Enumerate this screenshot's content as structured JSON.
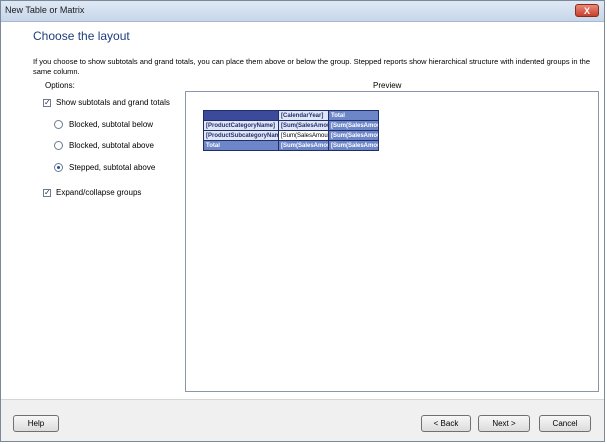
{
  "window": {
    "title": "New Table or Matrix",
    "close_label": "X"
  },
  "page": {
    "heading": "Choose the layout",
    "description": "If you choose to show subtotals and grand totals, you can place them above or below the group. Stepped reports show hierarchical structure with indented groups in the same column."
  },
  "options": {
    "label": "Options:",
    "show_subtotals": {
      "label": "Show subtotals and grand totals",
      "checked": true
    },
    "layouts": [
      {
        "label": "Blocked, subtotal below",
        "selected": false
      },
      {
        "label": "Blocked, subtotal above",
        "selected": false
      },
      {
        "label": "Stepped, subtotal above",
        "selected": true
      }
    ],
    "expand_collapse": {
      "label": "Expand/collapse groups",
      "checked": true
    }
  },
  "preview": {
    "label": "Preview",
    "rows": [
      [
        "",
        "[CalendarYear]",
        "Total"
      ],
      [
        "[ProductCategoryName]",
        "[Sum(SalesAmount)]",
        "[Sum(SalesAmount)]"
      ],
      [
        "[ProductSubcategoryName]",
        "[Sum(SalesAmount)]",
        "[Sum(SalesAmount)]"
      ],
      [
        "Total",
        "[Sum(SalesAmount)]",
        "[Sum(SalesAmount)]"
      ]
    ]
  },
  "footer": {
    "help_label": "Help",
    "back_label": "< Back",
    "next_label": "Next >",
    "cancel_label": "Cancel"
  },
  "colors": {
    "heading": "#1e3d7b",
    "matrix_dark": "#3b4a9a",
    "matrix_mid": "#6d86c8",
    "matrix_light": "#dfe6f6"
  }
}
